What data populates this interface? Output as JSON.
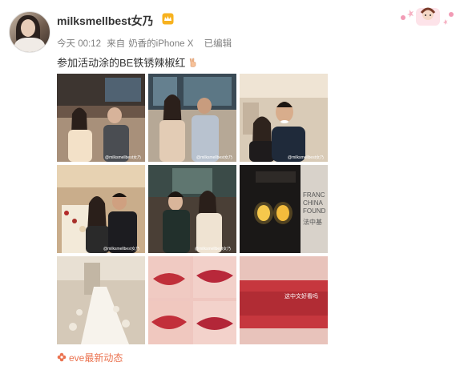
{
  "post": {
    "username": "milksmellbest女乃",
    "time": "今天 00:12",
    "source_prefix": "来自",
    "source": "奶香的iPhone X",
    "edited": "已编辑",
    "text": "参加活动涂的BE铁锈辣椒红",
    "photo_watermark": "@milksmellbest女乃",
    "photos": [
      {
        "subject": "group-photo-restaurant"
      },
      {
        "subject": "couple-photo-window"
      },
      {
        "subject": "selfie-couple"
      },
      {
        "subject": "dinner-table-group"
      },
      {
        "subject": "two-women-seated"
      },
      {
        "subject": "lanterns-sign"
      },
      {
        "subject": "long-banquet-table"
      },
      {
        "subject": "lip-closeups"
      },
      {
        "subject": "lipstick-swatch"
      }
    ],
    "sign_text": "FRANC CHINA FOUND 法中基金",
    "swatch_caption": "这中文好看吗",
    "topic": "eve最新动态"
  },
  "icons": {
    "vip": "vip-crown-icon",
    "peace": "peace-hand-icon",
    "topic": "flower-icon"
  },
  "colors": {
    "topic": "#eb7350",
    "meta": "#808080",
    "lip": "#c0303a"
  }
}
